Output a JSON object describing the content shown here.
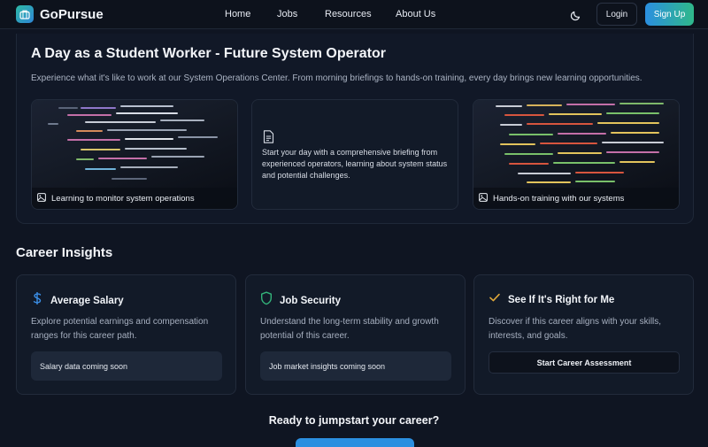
{
  "nav": {
    "brand": "GoPursue",
    "links": [
      "Home",
      "Jobs",
      "Resources",
      "About Us"
    ],
    "login": "Login",
    "signup": "Sign Up"
  },
  "day": {
    "title": "A Day as a Student Worker - Future System Operator",
    "description": "Experience what it's like to work at our System Operations Center. From morning briefings to hands-on training, every day brings new learning opportunities.",
    "tiles": [
      {
        "caption": "Learning to monitor system operations",
        "icon": "image-icon"
      },
      {
        "text": "Start your day with a comprehensive briefing from experienced operators, learning about system status and potential challenges.",
        "icon": "document-icon"
      },
      {
        "caption": "Hands-on training with our systems",
        "icon": "image-icon"
      }
    ]
  },
  "insights": {
    "title": "Career Insights",
    "cards": [
      {
        "title": "Average Salary",
        "description": "Explore potential earnings and compensation ranges for this career path.",
        "box": "Salary data coming soon",
        "icon": "dollar-icon"
      },
      {
        "title": "Job Security",
        "description": "Understand the long-term stability and growth potential of this career.",
        "box": "Job market insights coming soon",
        "icon": "shield-icon"
      },
      {
        "title": "See If It's Right for Me",
        "description": "Discover if this career aligns with your skills, interests, and goals.",
        "button": "Start Career Assessment",
        "icon": "check-icon"
      }
    ]
  },
  "cta": {
    "title": "Ready to jumpstart your career?"
  },
  "colors": {
    "background": "#0f1522",
    "card": "#121a28",
    "accent_blue": "#2b8fe0",
    "accent_green": "#2fb88a"
  }
}
